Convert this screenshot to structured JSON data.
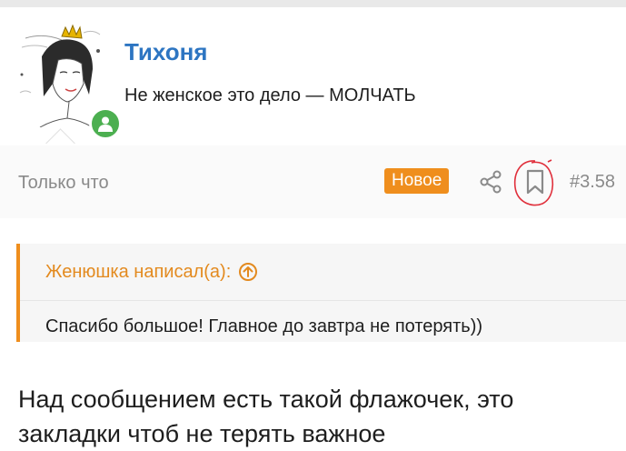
{
  "user": {
    "name": "Тихоня",
    "title": "Не женское это дело — МОЛЧАТЬ",
    "status_icon": "online-user-icon"
  },
  "meta": {
    "time": "Только что",
    "badge": "Новое",
    "post_number": "#3.58",
    "share_icon": "share-icon",
    "bookmark_icon": "bookmark-icon"
  },
  "quote": {
    "author": "Женюшка написал(а):",
    "text": "Спасибо большое! Главное до завтра не потерять))"
  },
  "post": {
    "line1": "Над сообщением есть такой флажочек, это",
    "line2": "закладки чтоб не терять важное"
  },
  "colors": {
    "accent": "#ef8e1d",
    "link": "#2d75c2",
    "online": "#4caf50",
    "annotation": "#e0303c"
  }
}
